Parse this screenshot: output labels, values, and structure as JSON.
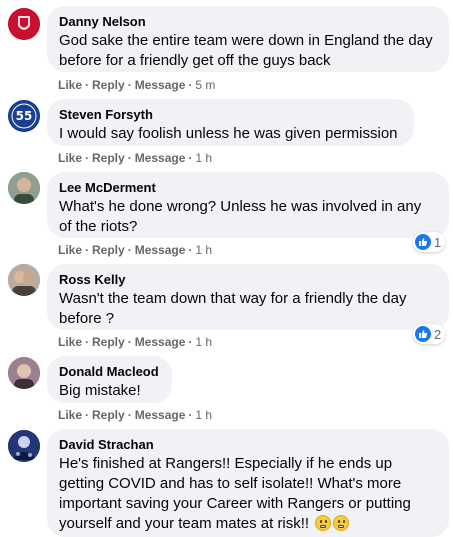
{
  "comments": [
    {
      "author": "Danny Nelson",
      "lines": [
        "God sake the entire team were down in England the day",
        "before for a friendly get off the guys back"
      ],
      "like": "Like",
      "reply": "Reply",
      "message": "Message",
      "time": "5 m",
      "avatar_color": "#c8102e"
    },
    {
      "author": "Steven Forsyth",
      "lines": [
        "I would say foolish unless he was given permission"
      ],
      "like": "Like",
      "reply": "Reply",
      "message": "Message",
      "time": "1 h",
      "avatar_text": "55",
      "avatar_color": "#1b3f8f"
    },
    {
      "author": "Lee McDerment",
      "lines": [
        "What's he done wrong? Unless he was involved in any",
        "of the riots?"
      ],
      "like": "Like",
      "reply": "Reply",
      "message": "Message",
      "time": "1 h",
      "reaction_count": "1",
      "avatar_color": "#6b7a6a"
    },
    {
      "author": "Ross Kelly",
      "lines": [
        "Wasn't the team down that way for a friendly the day",
        "before ?"
      ],
      "like": "Like",
      "reply": "Reply",
      "message": "Message",
      "time": "1 h",
      "reaction_count": "2",
      "avatar_color": "#8a7a70"
    },
    {
      "author": "Donald Macleod",
      "lines": [
        "Big mistake!"
      ],
      "like": "Like",
      "reply": "Reply",
      "message": "Message",
      "time": "1 h",
      "avatar_color": "#7a6070"
    },
    {
      "author": "David Strachan",
      "lines": [
        "He's finished at Rangers!! Especially if he ends up",
        "getting COVID and has to self isolate!! What's more",
        "important saving your Career with Rangers or putting",
        "yourself and your team mates at risk!!"
      ],
      "avatar_color": "#1f2f6b"
    }
  ],
  "colors": {
    "bubble": "#f0f2f5",
    "meta": "#65676b",
    "like_blue": "#1877f2"
  },
  "icons": {
    "reaction": "like-thumb-icon",
    "emoji": "grimacing-face-icon"
  }
}
